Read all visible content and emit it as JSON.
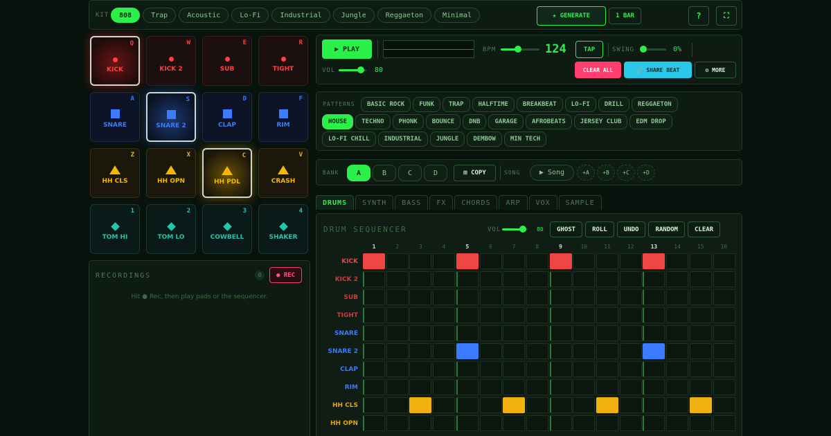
{
  "topbar": {
    "kit_label": "KIT",
    "kits": [
      "808",
      "Trap",
      "Acoustic",
      "Lo-Fi",
      "Industrial",
      "Jungle",
      "Reggaeton",
      "Minimal"
    ],
    "active_kit": 0,
    "generate_label": "★ GENERATE",
    "bars_label": "1 BAR",
    "help_label": "?",
    "fullscreen_label": "⛶"
  },
  "pads": [
    {
      "name": "KICK",
      "key": "Q",
      "color": "red",
      "icon": "dot",
      "selected": true
    },
    {
      "name": "KICK 2",
      "key": "W",
      "color": "red",
      "icon": "dot",
      "selected": false
    },
    {
      "name": "SUB",
      "key": "E",
      "color": "red",
      "icon": "dot",
      "selected": false
    },
    {
      "name": "TIGHT",
      "key": "R",
      "color": "red",
      "icon": "dot",
      "selected": false
    },
    {
      "name": "SNARE",
      "key": "A",
      "color": "blue",
      "icon": "square",
      "selected": false
    },
    {
      "name": "SNARE 2",
      "key": "S",
      "color": "blue",
      "icon": "square",
      "selected": true
    },
    {
      "name": "CLAP",
      "key": "D",
      "color": "blue",
      "icon": "square",
      "selected": false
    },
    {
      "name": "RIM",
      "key": "F",
      "color": "blue",
      "icon": "square",
      "selected": false
    },
    {
      "name": "HH CLS",
      "key": "Z",
      "color": "yellow",
      "icon": "triangle",
      "selected": false
    },
    {
      "name": "HH OPN",
      "key": "X",
      "color": "yellow",
      "icon": "triangle",
      "selected": false
    },
    {
      "name": "HH PDL",
      "key": "C",
      "color": "yellow",
      "icon": "triangle",
      "selected": true
    },
    {
      "name": "CRASH",
      "key": "V",
      "color": "yellow",
      "icon": "triangle",
      "selected": false
    },
    {
      "name": "TOM HI",
      "key": "1",
      "color": "teal",
      "icon": "diamond",
      "selected": false
    },
    {
      "name": "TOM LO",
      "key": "2",
      "color": "teal",
      "icon": "diamond",
      "selected": false
    },
    {
      "name": "COWBELL",
      "key": "3",
      "color": "teal",
      "icon": "diamond",
      "selected": false
    },
    {
      "name": "SHAKER",
      "key": "4",
      "color": "teal",
      "icon": "diamond",
      "selected": false
    }
  ],
  "recordings": {
    "title": "RECORDINGS",
    "count": "0",
    "rec_label": "● REC",
    "hint": "Hit ● Rec, then play pads or the sequencer."
  },
  "transport": {
    "play_label": "▶ PLAY",
    "bpm_label": "BPM",
    "bpm_value": "124",
    "bpm_level": 0.45,
    "tap_label": "TAP",
    "swing_label": "SWING",
    "swing_value": "0%",
    "swing_level": 0.0,
    "vol_label": "VOL",
    "vol_value": "80",
    "vol_level": 0.8,
    "clear_all_label": "CLEAR ALL",
    "share_label": "🔗 SHARE BEAT",
    "more_label": "⚙ MORE"
  },
  "patterns": {
    "label": "PATTERNS",
    "rows": [
      [
        "BASIC ROCK",
        "FUNK",
        "TRAP",
        "HALFTIME",
        "BREAKBEAT",
        "LO-FI",
        "DRILL",
        "REGGAETON"
      ],
      [
        "HOUSE",
        "TECHNO",
        "PHONK",
        "BOUNCE",
        "DNB",
        "GARAGE",
        "AFROBEATS",
        "JERSEY CLUB",
        "EDM DROP"
      ],
      [
        "LO-FI CHILL",
        "INDUSTRIAL",
        "JUNGLE",
        "DEMBOW",
        "MIN TECH"
      ]
    ],
    "active": "HOUSE"
  },
  "bank": {
    "label": "BANK",
    "banks": [
      "A",
      "B",
      "C",
      "D"
    ],
    "active_bank": 0,
    "copy_label": "⊞ COPY",
    "song_label": "SONG",
    "song_button": "▶ Song",
    "add_buttons": [
      "+A",
      "+B",
      "+C",
      "+D"
    ]
  },
  "tabs": [
    "DRUMS",
    "SYNTH",
    "BASS",
    "FX",
    "CHORDS",
    "ARP",
    "VOX",
    "SAMPLE"
  ],
  "active_tab": 0,
  "sequencer": {
    "title": "DRUM SEQUENCER",
    "vol_label": "VOL",
    "vol_value": "80",
    "vol_level": 0.8,
    "buttons": [
      "GHOST",
      "ROLL",
      "UNDO",
      "RANDOM",
      "CLEAR"
    ],
    "steps": [
      "1",
      "2",
      "3",
      "4",
      "5",
      "6",
      "7",
      "8",
      "9",
      "10",
      "11",
      "12",
      "13",
      "14",
      "15",
      "16"
    ],
    "tracks": [
      {
        "name": "KICK",
        "color": "#e24848",
        "fill": "red",
        "on": [
          1,
          5,
          9,
          13
        ]
      },
      {
        "name": "KICK 2",
        "color": "#d03c3c",
        "fill": "red",
        "on": []
      },
      {
        "name": "SUB",
        "color": "#d03c3c",
        "fill": "red",
        "on": []
      },
      {
        "name": "TIGHT",
        "color": "#d03c3c",
        "fill": "red",
        "on": []
      },
      {
        "name": "SNARE",
        "color": "#3a7bff",
        "fill": "blue",
        "on": []
      },
      {
        "name": "SNARE 2",
        "color": "#3a7bff",
        "fill": "blue",
        "on": [
          5,
          13
        ]
      },
      {
        "name": "CLAP",
        "color": "#3a7bff",
        "fill": "blue",
        "on": []
      },
      {
        "name": "RIM",
        "color": "#3a7bff",
        "fill": "blue",
        "on": []
      },
      {
        "name": "HH CLS",
        "color": "#e0a810",
        "fill": "yellow",
        "on": [
          3,
          7,
          11,
          15
        ]
      },
      {
        "name": "HH OPN",
        "color": "#e0a810",
        "fill": "yellow",
        "on": []
      }
    ]
  },
  "colors": {
    "accent": "#2cf04a",
    "red": "#f04545",
    "blue": "#3a7bff",
    "yellow": "#f0b010",
    "teal": "#26c4ac",
    "pink": "#ff3d6e",
    "cyan": "#28c8e8"
  }
}
